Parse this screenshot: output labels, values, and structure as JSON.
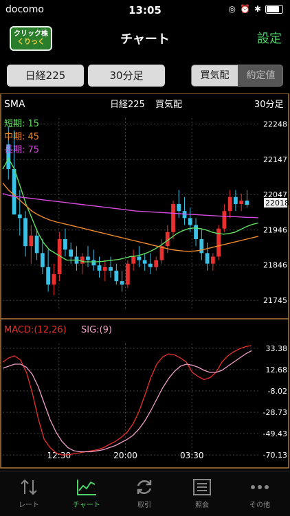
{
  "status": {
    "carrier": "docomo",
    "time": "13:05"
  },
  "nav": {
    "logo_line1": "クリック株",
    "logo_line2": "くりっく",
    "title": "チャート",
    "settings": "設定"
  },
  "toolbar": {
    "symbol": "日経225",
    "period": "30分足",
    "seg": [
      "買気配",
      "約定値"
    ],
    "seg_selected": 0
  },
  "chart": {
    "indicator": "SMA",
    "header_symbol": "日経225",
    "header_quote": "買気配",
    "header_period": "30分足",
    "legend": [
      {
        "label": "短期: 15",
        "color": "#5fe05f"
      },
      {
        "label": "中期: 45",
        "color": "#f08a2a"
      },
      {
        "label": "長期: 75",
        "color": "#d84be0"
      }
    ],
    "current_price": "22018",
    "macd_label": "MACD:(12,26)",
    "sig_label": "SIG:(9)",
    "time_labels": [
      "12:30",
      "20:00",
      "03:30"
    ]
  },
  "chart_data": [
    {
      "type": "candlestick",
      "title": "",
      "y_ticks": [
        22248,
        22147,
        22047,
        21946,
        21846,
        21745
      ],
      "ylim": [
        21720,
        22265
      ],
      "x_ticks": [
        "12:30",
        "20:00",
        "03:30"
      ],
      "candles": [
        [
          22190,
          22240,
          22090,
          22120
        ],
        [
          22120,
          22230,
          22050,
          21990
        ],
        [
          21990,
          22060,
          21930,
          21980
        ],
        [
          21980,
          22000,
          21870,
          21900
        ],
        [
          21900,
          21960,
          21850,
          21930
        ],
        [
          21930,
          21950,
          21860,
          21880
        ],
        [
          21880,
          21920,
          21820,
          21840
        ],
        [
          21840,
          21890,
          21770,
          21790
        ],
        [
          21790,
          21850,
          21760,
          21820
        ],
        [
          21820,
          21940,
          21800,
          21920
        ],
        [
          21920,
          21950,
          21870,
          21890
        ],
        [
          21890,
          21910,
          21850,
          21870
        ],
        [
          21870,
          21900,
          21830,
          21850
        ],
        [
          21850,
          21880,
          21820,
          21870
        ],
        [
          21870,
          21900,
          21840,
          21860
        ],
        [
          21860,
          21890,
          21830,
          21845
        ],
        [
          21845,
          21870,
          21810,
          21830
        ],
        [
          21830,
          21860,
          21800,
          21840
        ],
        [
          21840,
          21870,
          21810,
          21830
        ],
        [
          21830,
          21850,
          21790,
          21800
        ],
        [
          21800,
          21830,
          21770,
          21790
        ],
        [
          21790,
          21860,
          21780,
          21850
        ],
        [
          21850,
          21890,
          21830,
          21870
        ],
        [
          21870,
          21900,
          21840,
          21860
        ],
        [
          21860,
          21880,
          21830,
          21850
        ],
        [
          21850,
          21880,
          21820,
          21840
        ],
        [
          21840,
          21870,
          21830,
          21860
        ],
        [
          21860,
          21920,
          21850,
          21900
        ],
        [
          21900,
          21960,
          21880,
          21940
        ],
        [
          21940,
          22030,
          21920,
          22020
        ],
        [
          22020,
          22060,
          21980,
          22000
        ],
        [
          22000,
          22040,
          21960,
          21980
        ],
        [
          21980,
          22010,
          21940,
          21960
        ],
        [
          21960,
          21980,
          21900,
          21920
        ],
        [
          21920,
          21950,
          21860,
          21880
        ],
        [
          21880,
          21910,
          21830,
          21850
        ],
        [
          21850,
          21880,
          21830,
          21870
        ],
        [
          21870,
          21960,
          21860,
          21950
        ],
        [
          21950,
          22020,
          21940,
          22000
        ],
        [
          22000,
          22060,
          21980,
          22040
        ],
        [
          22040,
          22060,
          22000,
          22020
        ],
        [
          22020,
          22050,
          22000,
          22030
        ],
        [
          22030,
          22060,
          22010,
          22018
        ]
      ],
      "series": [
        {
          "name": "短期: 15",
          "color": "#5fe05f",
          "values": [
            22120,
            22150,
            22120,
            22070,
            22020,
            21980,
            21940,
            21910,
            21890,
            21880,
            21870,
            21860,
            21860,
            21860,
            21855,
            21855,
            21855,
            21856,
            21858,
            21860,
            21862,
            21866,
            21870,
            21872,
            21876,
            21882,
            21890,
            21900,
            21912,
            21924,
            21936,
            21944,
            21950,
            21952,
            21950,
            21946,
            21940,
            21936,
            21934,
            21936,
            21940,
            21948,
            21956,
            21962,
            21966
          ]
        },
        {
          "name": "中期: 45",
          "color": "#f08a2a",
          "values": [
            22080,
            22060,
            22045,
            22030,
            22015,
            22000,
            21990,
            21982,
            21975,
            21970,
            21966,
            21962,
            21958,
            21954,
            21950,
            21946,
            21942,
            21938,
            21934,
            21930,
            21926,
            21922,
            21918,
            21914,
            21910,
            21906,
            21902,
            21898,
            21894,
            21890,
            21888,
            21886,
            21885,
            21886,
            21888,
            21892,
            21896,
            21900,
            21904,
            21908,
            21912,
            21916,
            21920,
            21924,
            21928
          ]
        },
        {
          "name": "長期: 75",
          "color": "#d84be0",
          "values": [
            22050,
            22045,
            22042,
            22040,
            22038,
            22036,
            22034,
            22032,
            22030,
            22028,
            22026,
            22024,
            22022,
            22020,
            22018,
            22016,
            22014,
            22012,
            22010,
            22008,
            22006,
            22004,
            22002,
            22000,
            21999,
            21998,
            21997,
            21996,
            21995,
            21994,
            21993,
            21992,
            21991,
            21990,
            21989,
            21988,
            21987,
            21986,
            21985,
            21984,
            21984,
            21983,
            21982,
            21982,
            21981
          ]
        }
      ]
    },
    {
      "type": "line",
      "title": "",
      "y_ticks": [
        33.38,
        12.68,
        -8.02,
        -28.73,
        -49.43,
        -70.13
      ],
      "ylim": [
        -74,
        38
      ],
      "series": [
        {
          "name": "MACD:(12,26)",
          "color": "#e8302f",
          "values": [
            20,
            24,
            26,
            22,
            10,
            -10,
            -35,
            -55,
            -63,
            -68,
            -70,
            -70,
            -69,
            -68,
            -67,
            -66,
            -65,
            -63,
            -60,
            -57,
            -53,
            -48,
            -40,
            -28,
            -12,
            5,
            18,
            25,
            28,
            27,
            24,
            20,
            10,
            6,
            3,
            5,
            10,
            20,
            26,
            30,
            33,
            35,
            36
          ]
        },
        {
          "name": "SIG:(9)",
          "color": "#f0a0c8",
          "values": [
            14,
            16,
            18,
            18,
            15,
            8,
            -4,
            -20,
            -36,
            -48,
            -57,
            -63,
            -66,
            -67,
            -67,
            -67,
            -66,
            -65,
            -63,
            -61,
            -58,
            -55,
            -51,
            -45,
            -37,
            -27,
            -16,
            -5,
            4,
            11,
            16,
            18,
            17,
            15,
            12,
            10,
            10,
            12,
            16,
            20,
            24,
            28,
            31
          ]
        }
      ]
    }
  ],
  "tabs": [
    {
      "label": "レート",
      "icon": "updown-arrows-icon"
    },
    {
      "label": "チャート",
      "icon": "chart-icon"
    },
    {
      "label": "取引",
      "icon": "refresh-cycle-icon"
    },
    {
      "label": "照会",
      "icon": "list-icon"
    },
    {
      "label": "その他",
      "icon": "more-icon"
    }
  ],
  "colors": {
    "up": "#e8302f",
    "down": "#3ac1e8",
    "accent": "#4cd36a",
    "grid": "#444444",
    "border": "#b07a3a"
  }
}
